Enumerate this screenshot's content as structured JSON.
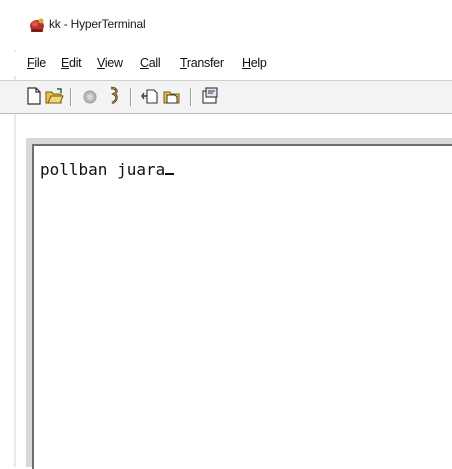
{
  "window": {
    "title": "kk - HyperTerminal"
  },
  "menu": {
    "items": [
      {
        "mnemonic": "F",
        "rest": "ile"
      },
      {
        "mnemonic": "E",
        "rest": "dit"
      },
      {
        "mnemonic": "V",
        "rest": "iew"
      },
      {
        "mnemonic": "C",
        "rest": "all"
      },
      {
        "mnemonic": "T",
        "rest": "ransfer"
      },
      {
        "mnemonic": "H",
        "rest": "elp"
      }
    ]
  },
  "toolbar": {
    "buttons": [
      "new-icon",
      "open-icon",
      "disconnect-icon",
      "dial-icon",
      "send-icon",
      "receive-icon",
      "properties-icon"
    ]
  },
  "terminal": {
    "text": "pollban juara"
  },
  "colors": {
    "toolbar_bg": "#f3f3f3",
    "terminal_bg": "#ffffff",
    "text": "#111111"
  }
}
